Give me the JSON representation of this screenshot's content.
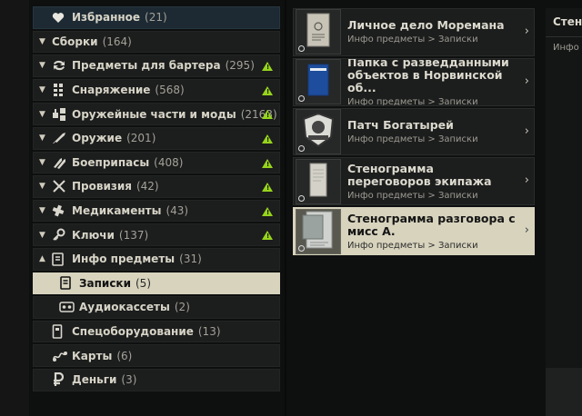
{
  "categories": [
    {
      "label": "Избранное",
      "count": "(21)",
      "icon": "heart-icon",
      "chevron": "",
      "warn": false,
      "variant": "fav"
    },
    {
      "label": "Сборки",
      "count": "(164)",
      "icon": "",
      "chevron": "▼",
      "warn": false,
      "variant": ""
    },
    {
      "label": "Предметы для бартера",
      "count": "(295)",
      "icon": "barter-icon",
      "chevron": "▼",
      "warn": true,
      "variant": ""
    },
    {
      "label": "Снаряжение",
      "count": "(568)",
      "icon": "gear-icon",
      "chevron": "▼",
      "warn": true,
      "variant": ""
    },
    {
      "label": "Оружейные части и моды",
      "count": "(2163)",
      "icon": "weapon-parts-icon",
      "chevron": "▼",
      "warn": true,
      "variant": ""
    },
    {
      "label": "Оружие",
      "count": "(201)",
      "icon": "rifle-icon",
      "chevron": "▼",
      "warn": true,
      "variant": ""
    },
    {
      "label": "Боеприпасы",
      "count": "(408)",
      "icon": "ammo-icon",
      "chevron": "▼",
      "warn": true,
      "variant": ""
    },
    {
      "label": "Провизия",
      "count": "(42)",
      "icon": "provisions-icon",
      "chevron": "▼",
      "warn": true,
      "variant": ""
    },
    {
      "label": "Медикаменты",
      "count": "(43)",
      "icon": "medical-icon",
      "chevron": "▼",
      "warn": true,
      "variant": ""
    },
    {
      "label": "Ключи",
      "count": "(137)",
      "icon": "key-icon",
      "chevron": "▼",
      "warn": true,
      "variant": ""
    },
    {
      "label": "Инфо предметы",
      "count": "(31)",
      "icon": "info-items-icon",
      "chevron": "▲",
      "warn": false,
      "variant": ""
    },
    {
      "label": "Записки",
      "count": "(5)",
      "icon": "notes-icon",
      "chevron": "",
      "warn": false,
      "variant": "sub active"
    },
    {
      "label": "Аудиокассеты",
      "count": "(2)",
      "icon": "cassette-icon",
      "chevron": "",
      "warn": false,
      "variant": "sub"
    },
    {
      "label": "Спецоборудование",
      "count": "(13)",
      "icon": "special-equipment-icon",
      "chevron": "",
      "warn": false,
      "variant": ""
    },
    {
      "label": "Карты",
      "count": "(6)",
      "icon": "map-icon",
      "chevron": "",
      "warn": false,
      "variant": ""
    },
    {
      "label": "Деньги",
      "count": "(3)",
      "icon": "ruble-icon",
      "chevron": "",
      "warn": false,
      "variant": ""
    }
  ],
  "items": [
    {
      "name": "Личное дело Моремана",
      "path": "Инфо предметы > Записки",
      "thumb": "folder-icon",
      "active": false
    },
    {
      "name": "Папка с разведданными объектов в Норвинской об...",
      "path": "Инфо предметы > Записки",
      "thumb": "blue-folder-icon",
      "active": false
    },
    {
      "name": "Патч Богатырей",
      "path": "Инфо предметы > Записки",
      "thumb": "patch-icon",
      "active": false
    },
    {
      "name": "Стенограмма переговоров экипажа",
      "path": "Инфо предметы > Записки",
      "thumb": "paper-icon",
      "active": false
    },
    {
      "name": "Стенограмма разговора с мисс А.",
      "path": "Инфо предметы > Записки",
      "thumb": "paper-photo-icon",
      "active": true
    }
  ],
  "warn_symbol": "!",
  "arrow_symbol": "›",
  "right_panel": {
    "title": "Стенограмма разговора с мисс А.",
    "subtitle": "Инфо предметы > Записки"
  },
  "colors": {
    "active": "#d7d3bd",
    "warning": "#96d41c",
    "favorite": "#1d2a33"
  }
}
